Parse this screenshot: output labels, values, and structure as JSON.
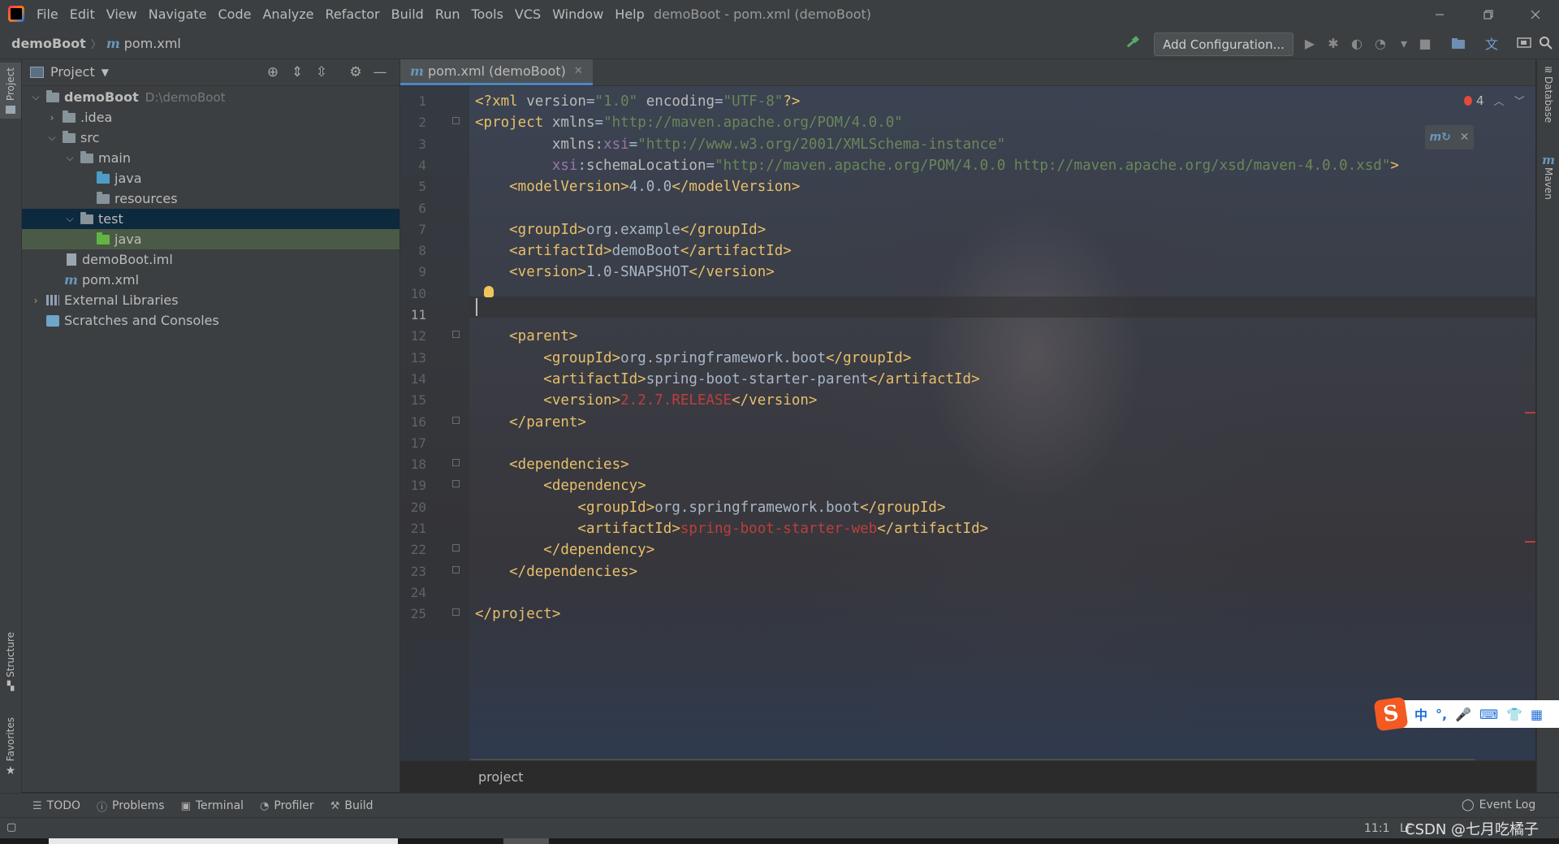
{
  "menu": [
    "File",
    "Edit",
    "View",
    "Navigate",
    "Code",
    "Analyze",
    "Refactor",
    "Build",
    "Run",
    "Tools",
    "VCS",
    "Window",
    "Help"
  ],
  "window_title": "demoBoot - pom.xml (demoBoot)",
  "breadcrumb": {
    "project": "demoBoot",
    "file": "pom.xml",
    "m": "m"
  },
  "toolbar": {
    "add_configuration": "Add Configuration..."
  },
  "left_tabs": {
    "project": "Project",
    "structure": "Structure",
    "favorites": "Favorites"
  },
  "right_tabs": {
    "database": "Database",
    "maven": "Maven"
  },
  "project_panel": {
    "title": "Project",
    "tree": [
      {
        "label": "demoBoot",
        "hint": "D:\\demoBoot"
      },
      {
        "label": ".idea"
      },
      {
        "label": "src"
      },
      {
        "label": "main"
      },
      {
        "label": "java"
      },
      {
        "label": "resources"
      },
      {
        "label": "test"
      },
      {
        "label": "java"
      },
      {
        "label": "demoBoot.iml"
      },
      {
        "label": "pom.xml"
      },
      {
        "label": "External Libraries"
      },
      {
        "label": "Scratches and Consoles"
      }
    ]
  },
  "editor": {
    "tab": "pom.xml (demoBoot)",
    "error_count": "4",
    "current_line": 11,
    "breadcrumb": "project",
    "lines": [
      [
        [
          "tag",
          "<?xml "
        ],
        [
          "attr",
          "version"
        ],
        [
          "txt",
          "="
        ],
        [
          "str",
          "\"1.0\""
        ],
        [
          "attr",
          " encoding"
        ],
        [
          "txt",
          "="
        ],
        [
          "str",
          "\"UTF-8\""
        ],
        [
          "tag",
          "?>"
        ]
      ],
      [
        [
          "tag",
          "<project "
        ],
        [
          "attr",
          "xmlns"
        ],
        [
          "txt",
          "="
        ],
        [
          "str",
          "\"http://maven.apache.org/POM/4.0.0\""
        ]
      ],
      [
        [
          "attr",
          "         xmlns"
        ],
        [
          "txt",
          ":"
        ],
        [
          "ns",
          "xsi"
        ],
        [
          "txt",
          "="
        ],
        [
          "str",
          "\"http://www.w3.org/2001/XMLSchema-instance\""
        ]
      ],
      [
        [
          "ns",
          "         xsi"
        ],
        [
          "txt",
          ":"
        ],
        [
          "attr",
          "schemaLocation"
        ],
        [
          "txt",
          "="
        ],
        [
          "str",
          "\"http://maven.apache.org/POM/4.0.0 http://maven.apache.org/xsd/maven-4.0.0.xsd\""
        ],
        [
          "tag",
          ">"
        ]
      ],
      [
        [
          "tag",
          "    <modelVersion>"
        ],
        [
          "txt",
          "4.0.0"
        ],
        [
          "tag",
          "</modelVersion>"
        ]
      ],
      [],
      [
        [
          "tag",
          "    <groupId>"
        ],
        [
          "txt",
          "org.example"
        ],
        [
          "tag",
          "</groupId>"
        ]
      ],
      [
        [
          "tag",
          "    <artifactId>"
        ],
        [
          "txt",
          "demoBoot"
        ],
        [
          "tag",
          "</artifactId>"
        ]
      ],
      [
        [
          "tag",
          "    <version>"
        ],
        [
          "txt",
          "1.0-SNAPSHOT"
        ],
        [
          "tag",
          "</version>"
        ]
      ],
      [],
      [],
      [
        [
          "tag",
          "    <parent>"
        ]
      ],
      [
        [
          "tag",
          "        <groupId>"
        ],
        [
          "txt",
          "org.springframework.boot"
        ],
        [
          "tag",
          "</groupId>"
        ]
      ],
      [
        [
          "tag",
          "        <artifactId>"
        ],
        [
          "txt",
          "spring-boot-starter-parent"
        ],
        [
          "tag",
          "</artifactId>"
        ]
      ],
      [
        [
          "tag",
          "        <version>"
        ],
        [
          "err",
          "2.2.7.RELEASE"
        ],
        [
          "tag",
          "</version>"
        ]
      ],
      [
        [
          "tag",
          "    </parent>"
        ]
      ],
      [],
      [
        [
          "tag",
          "    <dependencies>"
        ]
      ],
      [
        [
          "tag",
          "        <dependency>"
        ]
      ],
      [
        [
          "tag",
          "            <groupId>"
        ],
        [
          "txt",
          "org.springframework.boot"
        ],
        [
          "tag",
          "</groupId>"
        ]
      ],
      [
        [
          "tag",
          "            <artifactId>"
        ],
        [
          "err",
          "spring-boot-starter-web"
        ],
        [
          "tag",
          "</artifactId>"
        ]
      ],
      [
        [
          "tag",
          "        </dependency>"
        ]
      ],
      [
        [
          "tag",
          "    </dependencies>"
        ]
      ],
      [],
      [
        [
          "tag",
          "</project>"
        ]
      ]
    ]
  },
  "bottom_tools": [
    "TODO",
    "Problems",
    "Terminal",
    "Profiler",
    "Build"
  ],
  "event_log": "Event Log",
  "status": {
    "position": "11:1",
    "encoding": "LF"
  },
  "watermark": "CSDN @七月吃橘子",
  "ime": {
    "items": [
      "中",
      "°,",
      "🎤",
      "⌨",
      "👕",
      "▦"
    ]
  },
  "colors": {
    "tag": "#e8bf6a",
    "string": "#6a8759",
    "error": "#bc3f3c",
    "namespace": "#9876aa",
    "selection": "#0d293e"
  }
}
